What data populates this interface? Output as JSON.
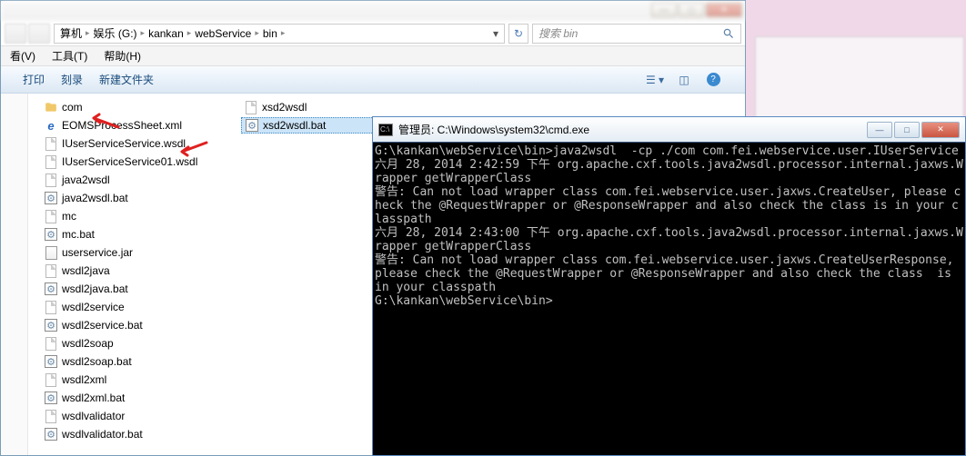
{
  "explorer": {
    "path": {
      "crumbs": [
        "算机",
        "娱乐 (G:)",
        "kankan",
        "webService",
        "bin"
      ]
    },
    "search_placeholder": "搜索 bin",
    "menubar": [
      "看(V)",
      "工具(T)",
      "帮助(H)"
    ],
    "toolbar": [
      "打印",
      "刻录",
      "新建文件夹"
    ],
    "files": [
      {
        "name": "com",
        "type": "folder"
      },
      {
        "name": "EOMSProcessSheet.xml",
        "type": "ie"
      },
      {
        "name": "IUserServiceService.wsdl",
        "type": "file"
      },
      {
        "name": "IUserServiceService01.wsdl",
        "type": "file"
      },
      {
        "name": "java2wsdl",
        "type": "file"
      },
      {
        "name": "java2wsdl.bat",
        "type": "bat"
      },
      {
        "name": "mc",
        "type": "file"
      },
      {
        "name": "mc.bat",
        "type": "bat"
      },
      {
        "name": "userservice.jar",
        "type": "jar"
      },
      {
        "name": "wsdl2java",
        "type": "file"
      },
      {
        "name": "wsdl2java.bat",
        "type": "bat"
      },
      {
        "name": "wsdl2service",
        "type": "file"
      },
      {
        "name": "wsdl2service.bat",
        "type": "bat"
      },
      {
        "name": "wsdl2soap",
        "type": "file"
      },
      {
        "name": "wsdl2soap.bat",
        "type": "bat"
      },
      {
        "name": "wsdl2xml",
        "type": "file"
      },
      {
        "name": "wsdl2xml.bat",
        "type": "bat"
      },
      {
        "name": "wsdlvalidator",
        "type": "file"
      },
      {
        "name": "wsdlvalidator.bat",
        "type": "bat"
      },
      {
        "name": "xsd2wsdl",
        "type": "file"
      },
      {
        "name": "xsd2wsdl.bat",
        "type": "bat",
        "selected": true
      }
    ],
    "winbtns": {
      "min": "—",
      "max": "□",
      "close": "✕"
    }
  },
  "cmd": {
    "title": "管理员: C:\\Windows\\system32\\cmd.exe",
    "icon_text": "C:\\",
    "lines": [
      "G:\\kankan\\webService\\bin>java2wsdl  -cp ./com com.fei.webservice.user.IUserService",
      "六月 28, 2014 2:42:59 下午 org.apache.cxf.tools.java2wsdl.processor.internal.jaxws.Wrapper getWrapperClass",
      "警告: Can not load wrapper class com.fei.webservice.user.jaxws.CreateUser, please check the @RequestWrapper or @ResponseWrapper and also check the class is in your classpath",
      "六月 28, 2014 2:43:00 下午 org.apache.cxf.tools.java2wsdl.processor.internal.jaxws.Wrapper getWrapperClass",
      "警告: Can not load wrapper class com.fei.webservice.user.jaxws.CreateUserResponse, please check the @RequestWrapper or @ResponseWrapper and also check the class  is in your classpath",
      "G:\\kankan\\webService\\bin>"
    ],
    "winbtns": {
      "min": "—",
      "max": "□",
      "close": "✕"
    }
  }
}
